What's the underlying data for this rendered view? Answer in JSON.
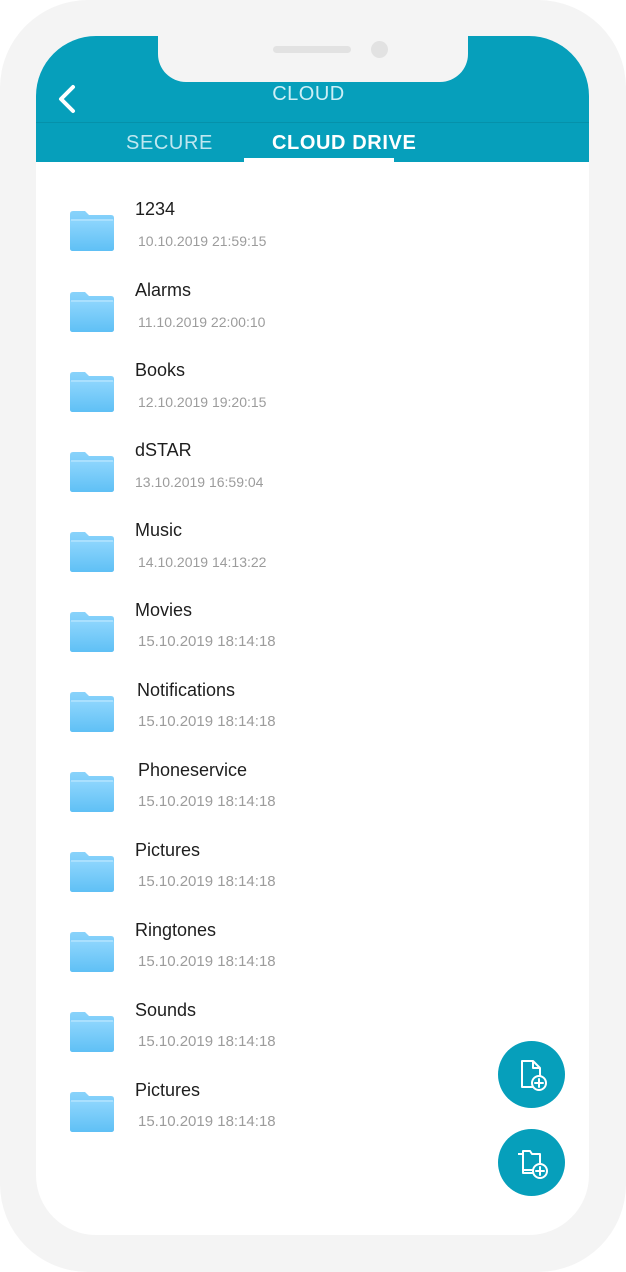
{
  "header": {
    "title": "CLOUD",
    "back_icon": "chevron-left-icon",
    "color": "#069fbb"
  },
  "tabs": [
    {
      "label": "SECURE",
      "active": false
    },
    {
      "label": "CLOUD DRIVE",
      "active": true
    }
  ],
  "folders": [
    {
      "name": "1234",
      "date": "10.10.2019 21:59:15"
    },
    {
      "name": "Alarms",
      "date": "11.10.2019 22:00:10"
    },
    {
      "name": "Books",
      "date": "12.10.2019 19:20:15"
    },
    {
      "name": "dSTAR",
      "date": "13.10.2019 16:59:04"
    },
    {
      "name": "Music",
      "date": "14.10.2019 14:13:22"
    },
    {
      "name": "Movies",
      "date": "15.10.2019 18:14:18"
    },
    {
      "name": "Notifications",
      "date": "15.10.2019 18:14:18"
    },
    {
      "name": "Phoneservice",
      "date": "15.10.2019 18:14:18"
    },
    {
      "name": "Pictures",
      "date": "15.10.2019 18:14:18"
    },
    {
      "name": "Ringtones",
      "date": "15.10.2019 18:14:18"
    },
    {
      "name": "Sounds",
      "date": "15.10.2019 18:14:18"
    },
    {
      "name": "Pictures",
      "date": "15.10.2019 18:14:18"
    }
  ],
  "actions": {
    "add_file_icon": "file-plus-icon",
    "add_folder_icon": "folder-plus-icon"
  }
}
